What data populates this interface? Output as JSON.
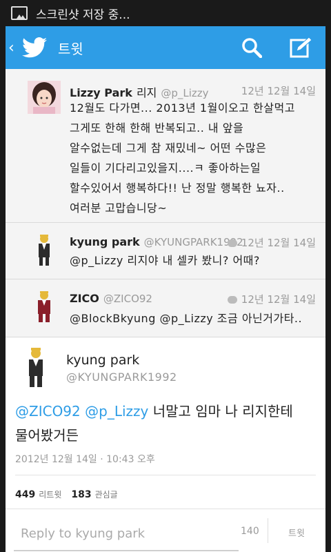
{
  "status_bar": {
    "text": "스크린샷 저장 중..."
  },
  "header": {
    "title": "트윗"
  },
  "tweets": [
    {
      "name": "Lizzy Park",
      "name2": "리지",
      "handle": "@p_Lizzy",
      "time": "12년 12월 14일",
      "text": "12월도 다가면... 2013년 1월이오고 한살먹고\n그게또 한해 한해 반복되고.. 내 앞을\n알수없는데 그게 참 재밌네~ 어떤 수많은\n일들이 기다리고있을지....ㅋ 좋아하는일\n할수있어서 행복하다!! 난 정말 행복한 뇨자..\n여러분 고맙습니당~"
    },
    {
      "name": "kyung park",
      "handle": "@KYUNGPARK1992",
      "time": "12년 12월 14일",
      "text": "@p_Lizzy 리지야 내 셀카 봤니? 어때?"
    },
    {
      "name": "ZICO",
      "handle": "@ZICO92",
      "time": "12년 12월 14일",
      "text": "@BlockBkyung @p_Lizzy 조금 아닌거가타.."
    }
  ],
  "main_tweet": {
    "name": "kyung park",
    "handle": "@KYUNGPARK1992",
    "mention1": "@ZICO92",
    "mention2": "@p_Lizzy",
    "text_line1": "너말고 임마 나 리지한테",
    "text_line2": "물어봤거든",
    "date": "2012년 12월 14일 · 10:43 오후",
    "retweets": "449",
    "retweets_label": "리트윗",
    "favorites": "183",
    "favorites_label": "관심글"
  },
  "reply": {
    "placeholder": "Reply to kyung park",
    "count": "140",
    "send_label": "트윗"
  },
  "colors": {
    "accent": "#2e9de6"
  }
}
